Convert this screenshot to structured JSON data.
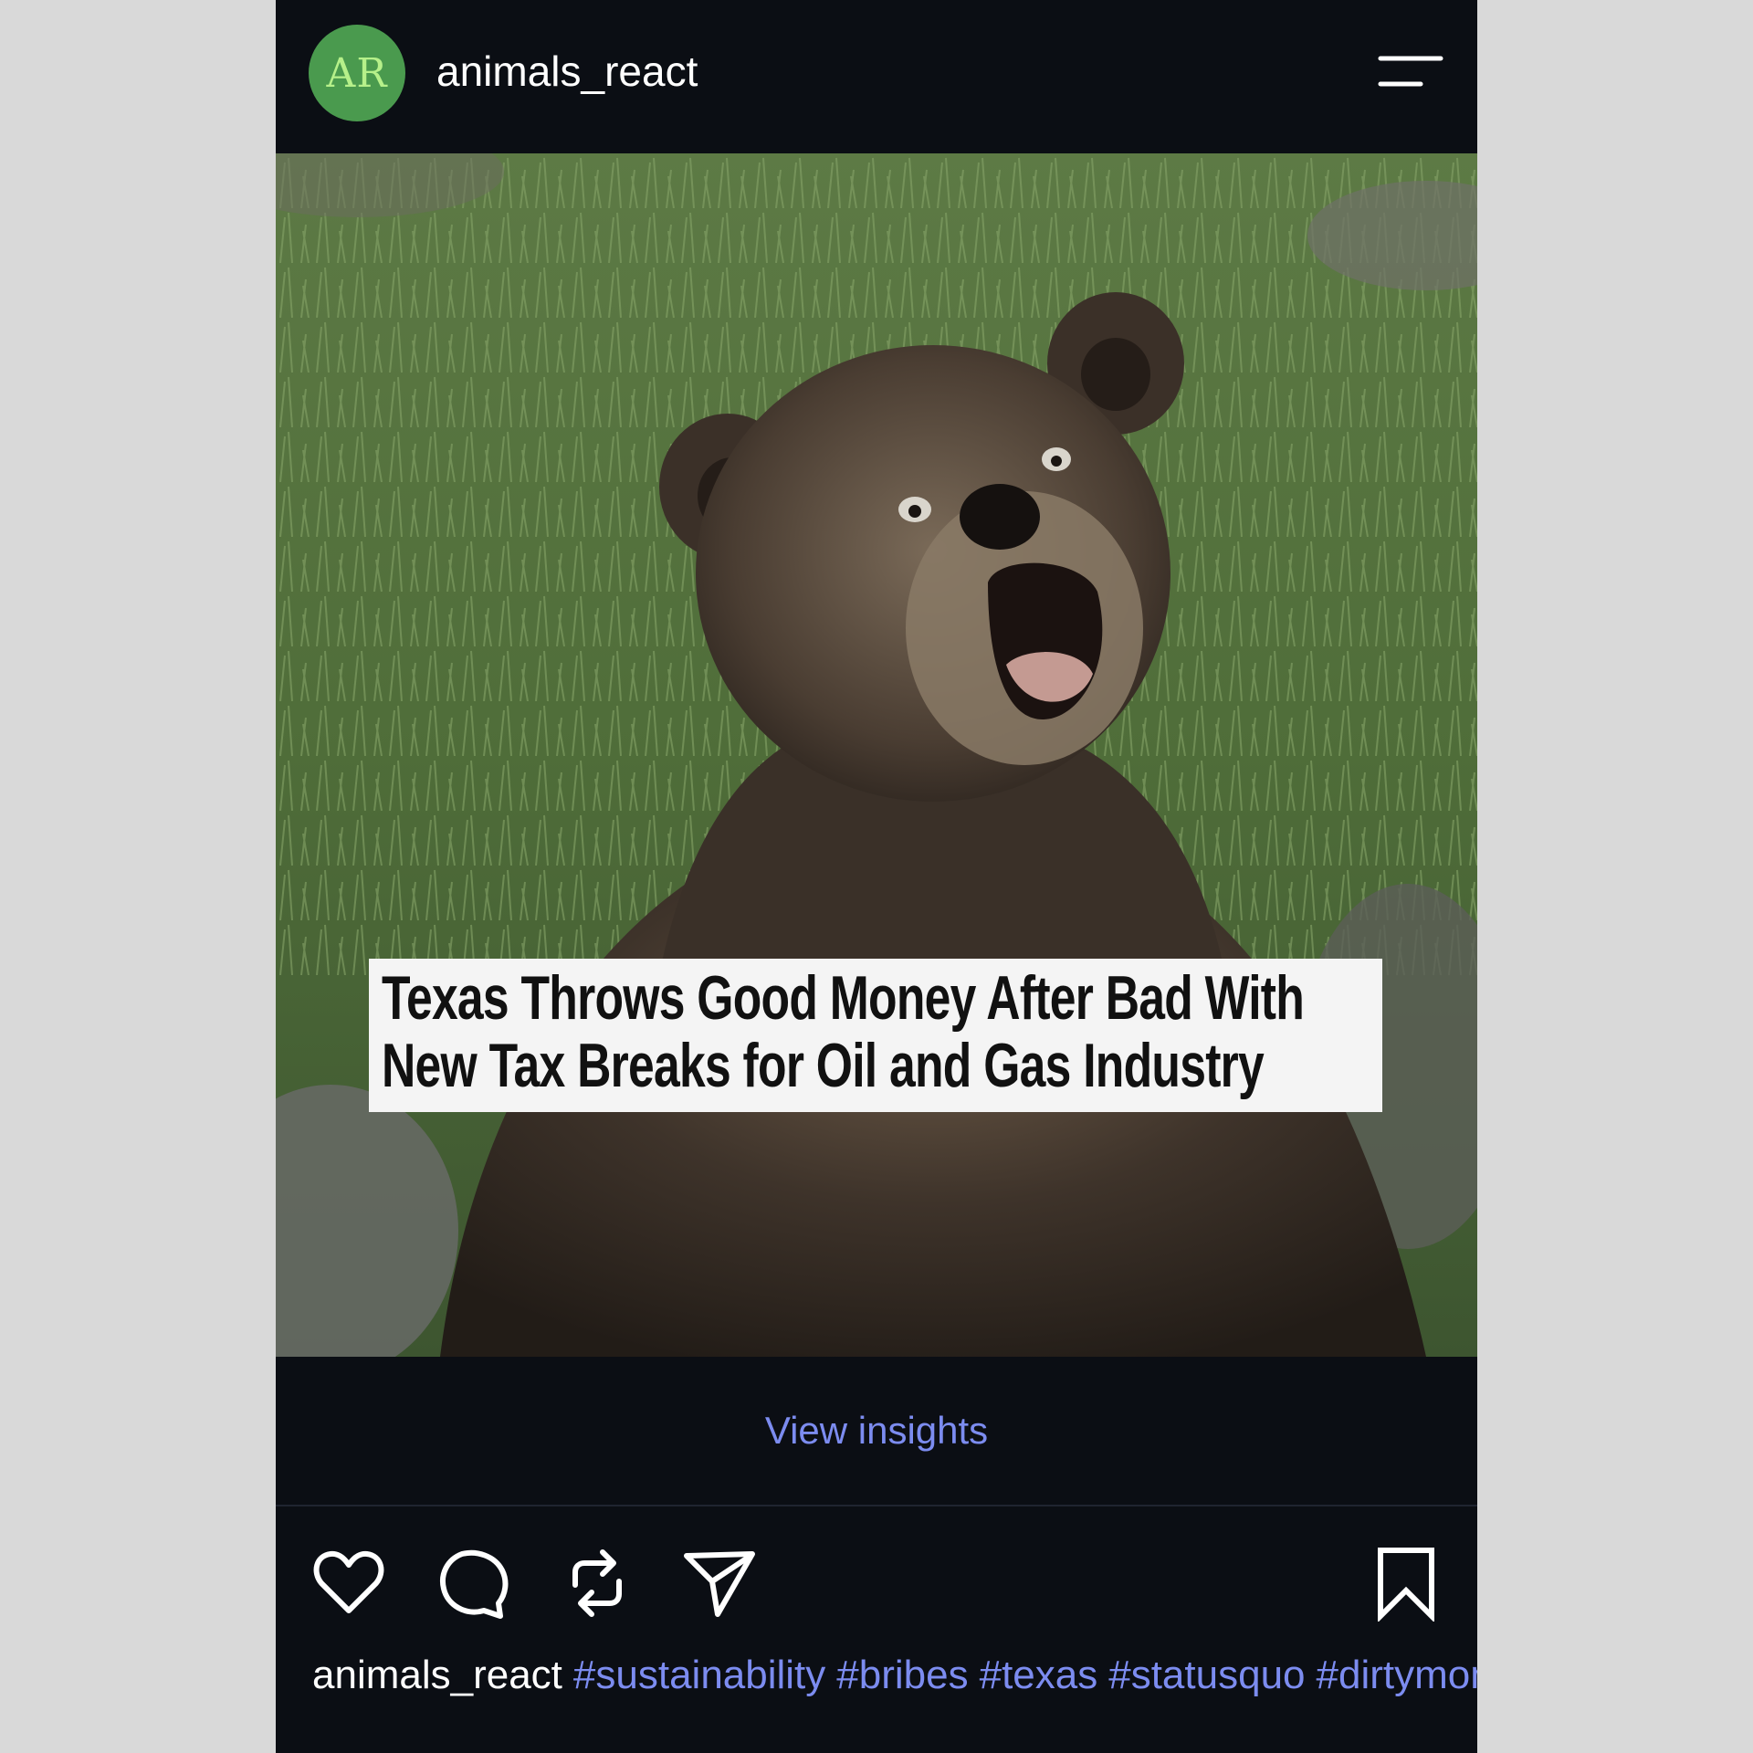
{
  "header": {
    "avatar_initials": "AR",
    "username": "animals_react",
    "menu_icon": "menu-icon"
  },
  "post": {
    "image_caption_lines": [
      "Texas Throws Good Money After Bad With",
      "New Tax Breaks for Oil and Gas Industry"
    ],
    "view_insights_label": "View insights"
  },
  "actions": {
    "like_icon": "heart-icon",
    "comment_icon": "comment-icon",
    "repost_icon": "repost-icon",
    "share_icon": "send-icon",
    "save_icon": "bookmark-icon"
  },
  "caption": {
    "username": "animals_react",
    "hashtags": [
      "#sustainability",
      "#bribes",
      "#texas",
      "#statusquo",
      "#dirtymoney"
    ]
  },
  "colors": {
    "background": "#0b0e14",
    "link": "#7c8cf0",
    "avatar": "#4a9a4e"
  }
}
